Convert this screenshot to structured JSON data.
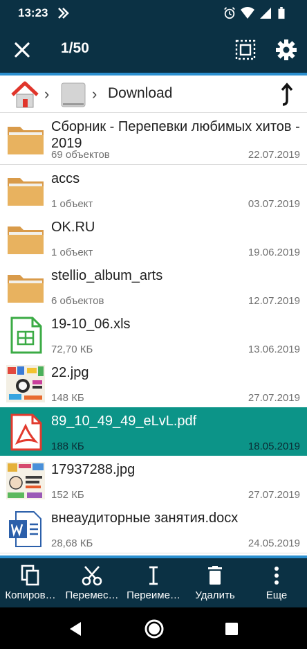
{
  "status": {
    "time": "13:23"
  },
  "appbar": {
    "title": "1/50"
  },
  "breadcrumb": {
    "folder": "Download"
  },
  "files": [
    {
      "name": "Сборник - Перепевки любимых хитов - 2019",
      "meta": "69 объектов",
      "date": "22.07.2019",
      "type": "folder"
    },
    {
      "name": "accs",
      "meta": "1 объект",
      "date": "03.07.2019",
      "type": "folder"
    },
    {
      "name": "OK.RU",
      "meta": "1 объект",
      "date": "19.06.2019",
      "type": "folder"
    },
    {
      "name": "stellio_album_arts",
      "meta": "6 объектов",
      "date": "12.07.2019",
      "type": "folder"
    },
    {
      "name": "19-10_06.xls",
      "meta": "72,70 КБ",
      "date": "13.06.2019",
      "type": "xls"
    },
    {
      "name": "22.jpg",
      "meta": "148 КБ",
      "date": "27.07.2019",
      "type": "image"
    },
    {
      "name": "89_10_49_49_eLvL.pdf",
      "meta": "188 КБ",
      "date": "18.05.2019",
      "type": "pdf"
    },
    {
      "name": "17937288.jpg",
      "meta": "152 КБ",
      "date": "27.07.2019",
      "type": "image"
    },
    {
      "name": "внеаудиторные занятия.docx",
      "meta": "28,68 КБ",
      "date": "24.05.2019",
      "type": "docx"
    }
  ],
  "bottombar": {
    "copy": "Копиров…",
    "move": "Перемес…",
    "rename": "Переиме…",
    "delete": "Удалить",
    "more": "Еще"
  },
  "colors": {
    "bar": "#0b3144",
    "accent": "#2b8fcf",
    "selected": "#0c9488"
  }
}
